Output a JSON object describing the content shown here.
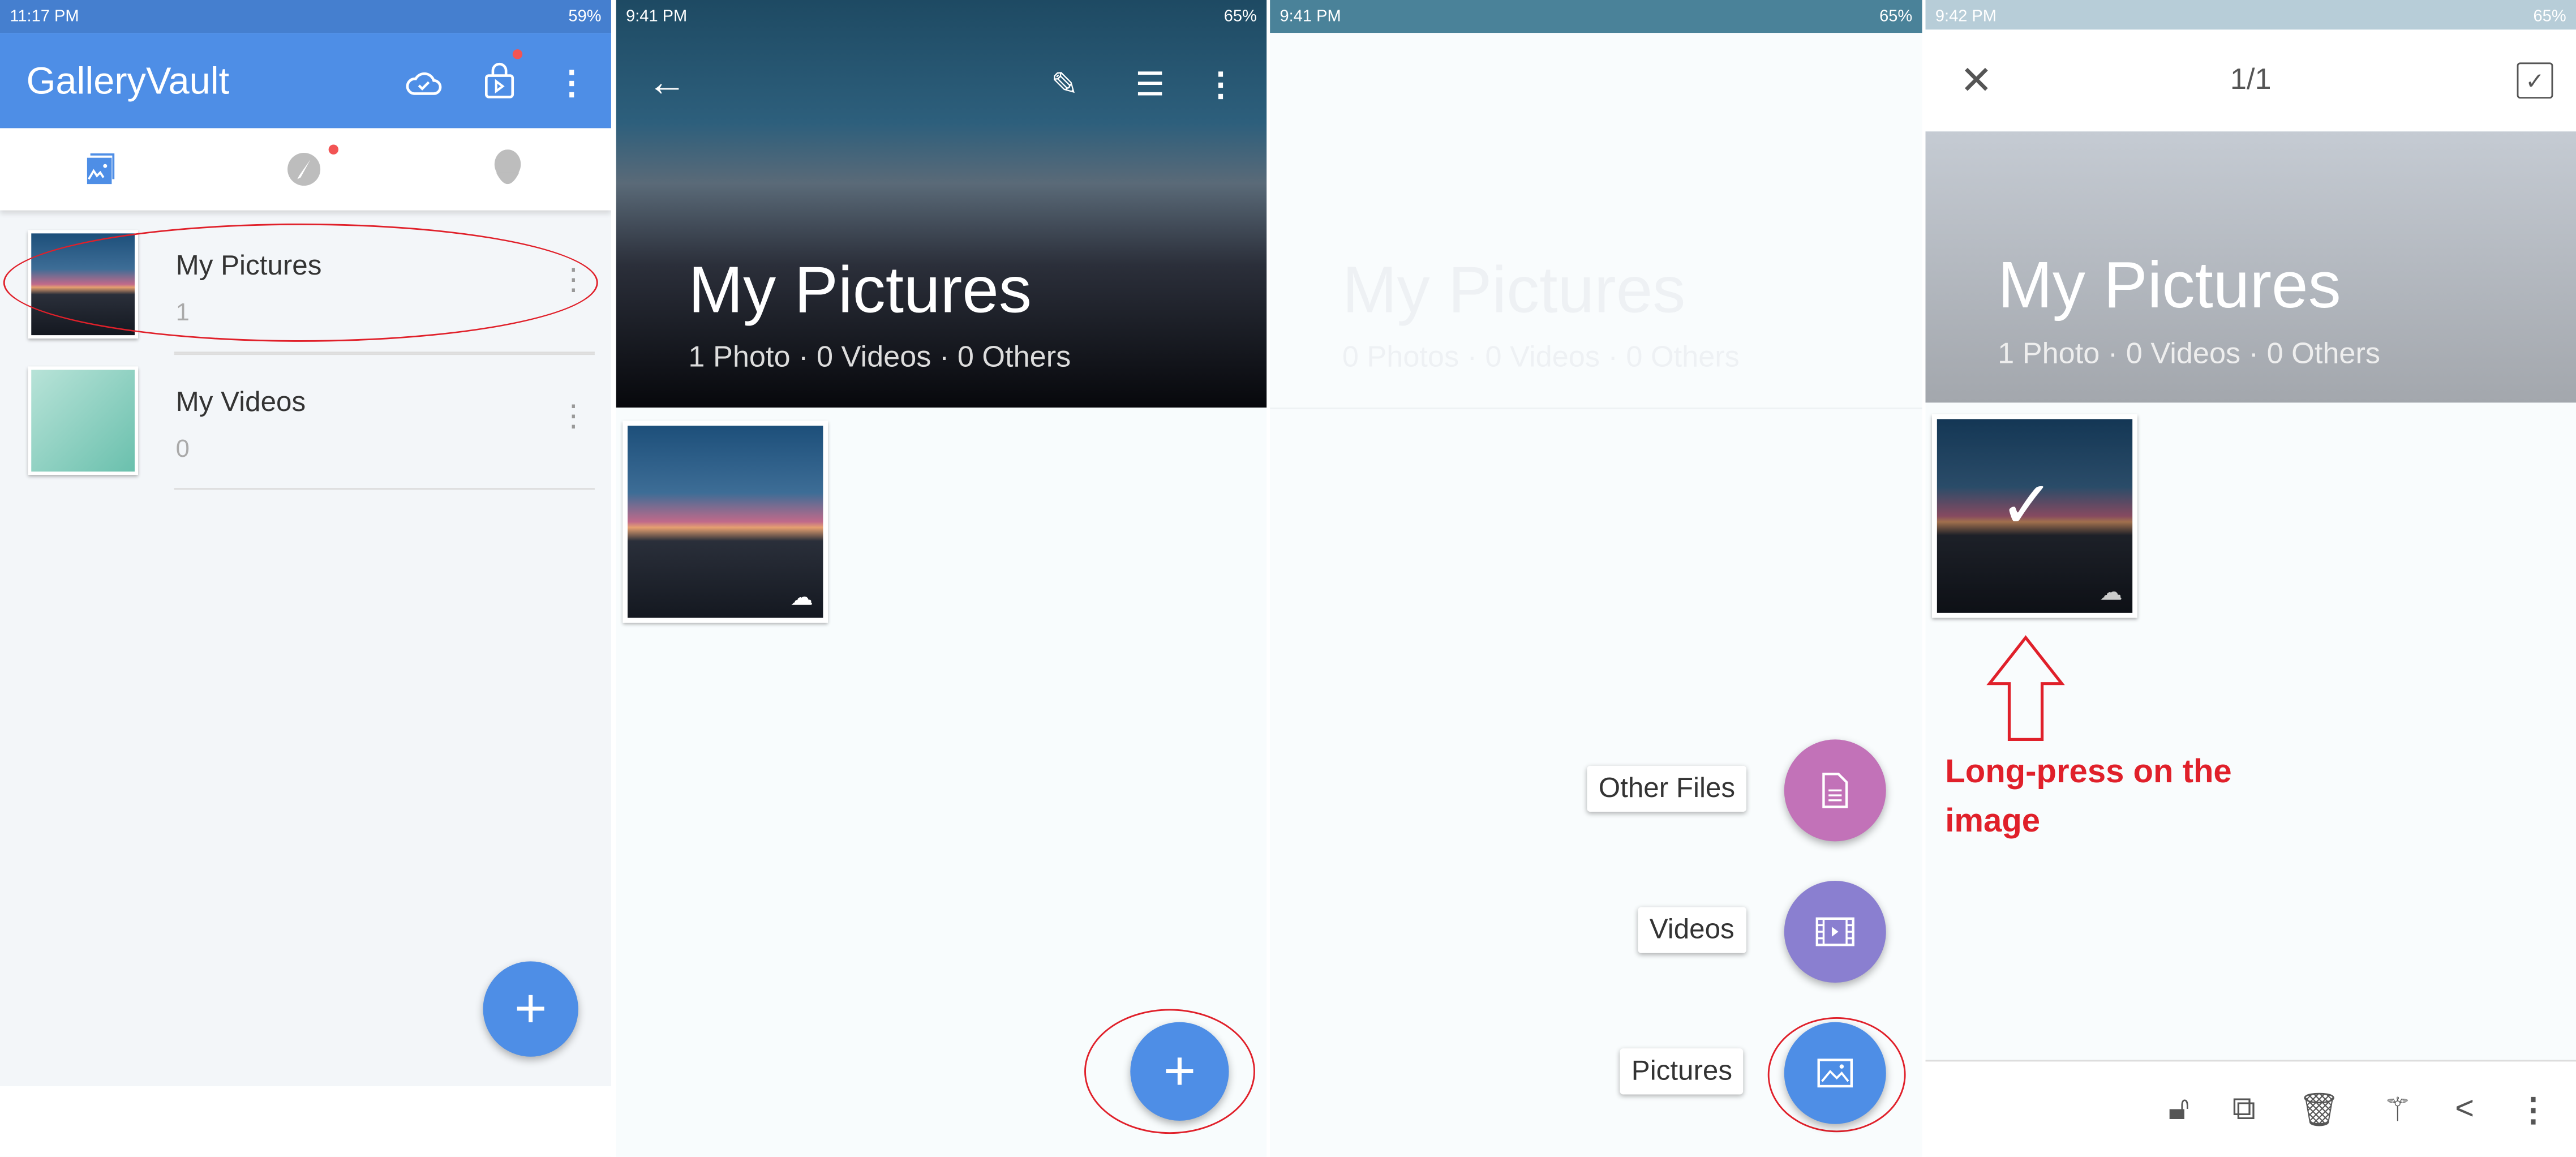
{
  "panel1": {
    "status": {
      "time": "11:17 PM",
      "battery": "59%"
    },
    "app_title": "GalleryVault",
    "tabs": [
      {
        "icon": "gallery-icon",
        "active": true
      },
      {
        "icon": "compass-icon",
        "badge": true
      },
      {
        "icon": "user-icon"
      }
    ],
    "folders": [
      {
        "name": "My Pictures",
        "count": "1"
      },
      {
        "name": "My Videos",
        "count": "0"
      }
    ],
    "accent": "#4e8ee6"
  },
  "panel2": {
    "status": {
      "time": "9:41 PM",
      "battery": "65%"
    },
    "title": "My Pictures",
    "subtitle": "1 Photo · 0 Videos · 0 Others"
  },
  "panel3": {
    "status": {
      "time": "9:41 PM",
      "battery": "65%"
    },
    "title": "My Pictures",
    "subtitle": "0 Photos · 0 Videos · 0 Others",
    "menu": [
      {
        "label": "Other Files",
        "color": "#c272b8"
      },
      {
        "label": "Videos",
        "color": "#8a7fd0"
      },
      {
        "label": "Pictures",
        "color": "#4e8ee6"
      }
    ]
  },
  "panel4": {
    "status": {
      "time": "9:42 PM",
      "battery": "65%"
    },
    "counter": "1/1",
    "title": "My Pictures",
    "subtitle": "1 Photo · 0 Videos · 0 Others",
    "annotation": "Long-press on the image",
    "toolbar": [
      "unlock-icon",
      "move-icon",
      "delete-icon",
      "magic-wand-icon",
      "share-icon",
      "more-icon"
    ]
  }
}
